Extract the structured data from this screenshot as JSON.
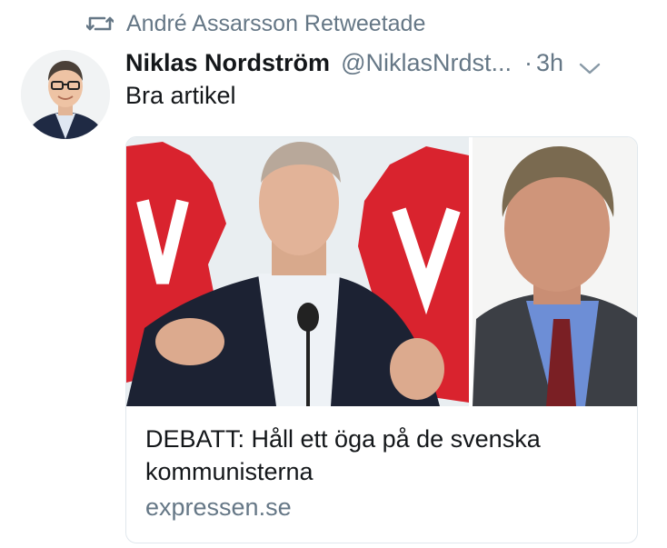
{
  "retweet": {
    "icon": "retweet-icon",
    "text": "André Assarsson Retweetade"
  },
  "tweet": {
    "avatar": "avatar",
    "display_name": "Niklas Nordström",
    "handle": "@NiklasNrdst...",
    "separator": "·",
    "time": "3h",
    "menu_icon": "chevron-down-icon",
    "text": "Bra artikel"
  },
  "card": {
    "title": "DEBATT: Håll ett öga på de svenska kommunisterna",
    "domain": "expressen.se"
  },
  "colors": {
    "primary_text": "#14171a",
    "secondary_text": "#657786",
    "card_border": "#e1e8ed",
    "accent_red": "#d9232e"
  }
}
